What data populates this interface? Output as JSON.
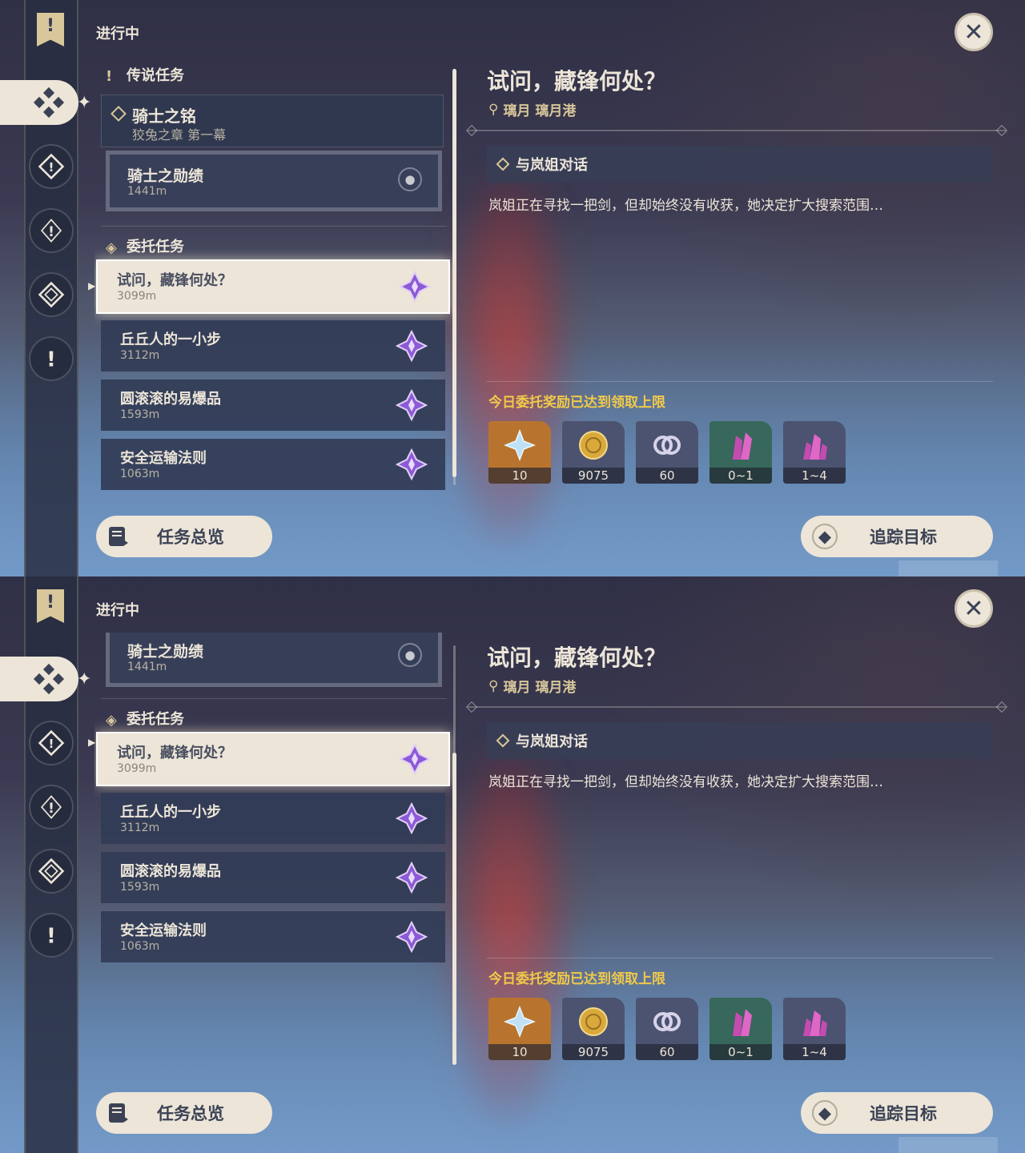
{
  "screens": [
    {
      "status": "进行中",
      "legend_section": "传说任务",
      "legend_quest": {
        "title": "骑士之铭",
        "subtitle": "狡兔之章 第一幕"
      },
      "sub_quest": {
        "title": "骑士之勋绩",
        "distance": "1441m"
      },
      "commission_section": "委托任务",
      "tasks": [
        {
          "title": "试问，藏锋何处？",
          "distance": "3099m",
          "selected": true
        },
        {
          "title": "丘丘人的一小步",
          "distance": "3112m"
        },
        {
          "title": "圆滚滚的易爆品",
          "distance": "1593m"
        },
        {
          "title": "安全运输法则",
          "distance": "1063m"
        }
      ],
      "detail": {
        "title": "试问，藏锋何处？",
        "location": "璃月 璃月港",
        "objective": "与岚姐对话",
        "description": "岚姐正在寻找一把剑，但却始终没有收获，她决定扩大搜索范围…",
        "reward_limit": "今日委托奖励已达到领取上限",
        "rewards": [
          {
            "name": "primogem",
            "amount": "10",
            "bg": "#b8742e"
          },
          {
            "name": "mora",
            "amount": "9075",
            "bg": "#4b5370"
          },
          {
            "name": "companionship-exp",
            "amount": "60",
            "bg": "#4b5370"
          },
          {
            "name": "crystal-green",
            "amount": "0~1",
            "bg": "#37685b"
          },
          {
            "name": "crystal-cluster",
            "amount": "1~4",
            "bg": "#4b5370"
          }
        ]
      },
      "buttons": {
        "overview": "任务总览",
        "track": "追踪目标"
      }
    },
    {
      "status": "进行中",
      "sub_quest": {
        "title": "骑士之勋绩",
        "distance": "1441m"
      },
      "commission_section": "委托任务",
      "tasks": [
        {
          "title": "试问，藏锋何处？",
          "distance": "3099m",
          "selected": true
        },
        {
          "title": "丘丘人的一小步",
          "distance": "3112m"
        },
        {
          "title": "圆滚滚的易爆品",
          "distance": "1593m"
        },
        {
          "title": "安全运输法则",
          "distance": "1063m"
        }
      ],
      "detail": {
        "title": "试问，藏锋何处？",
        "location": "璃月 璃月港",
        "objective": "与岚姐对话",
        "description": "岚姐正在寻找一把剑，但却始终没有收获，她决定扩大搜索范围…",
        "reward_limit": "今日委托奖励已达到领取上限",
        "rewards": [
          {
            "name": "primogem",
            "amount": "10",
            "bg": "#b8742e"
          },
          {
            "name": "mora",
            "amount": "9075",
            "bg": "#4b5370"
          },
          {
            "name": "companionship-exp",
            "amount": "60",
            "bg": "#4b5370"
          },
          {
            "name": "crystal-green",
            "amount": "0~1",
            "bg": "#37685b"
          },
          {
            "name": "crystal-cluster",
            "amount": "1~4",
            "bg": "#4b5370"
          }
        ]
      },
      "buttons": {
        "overview": "任务总览",
        "track": "追踪目标"
      }
    }
  ]
}
